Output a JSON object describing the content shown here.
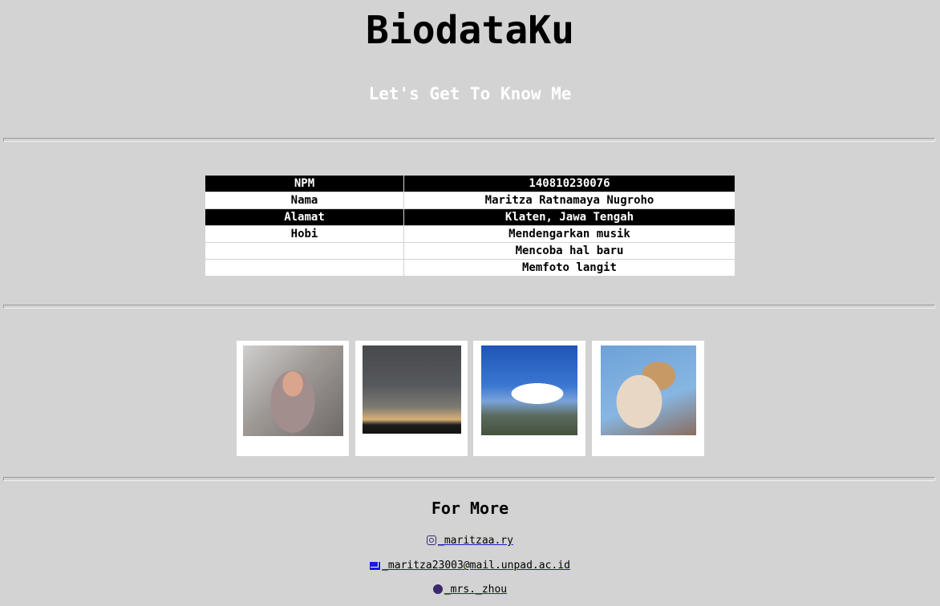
{
  "header": {
    "title": "BiodataKu",
    "subtitle": "Let's Get To Know Me"
  },
  "biodata": {
    "rows": [
      {
        "key": "NPM",
        "value": "140810230076"
      },
      {
        "key": "Nama",
        "value": "Maritza Ratnamaya Nugroho"
      },
      {
        "key": "Alamat",
        "value": "Klaten, Jawa Tengah"
      },
      {
        "key": "Hobi",
        "value": "Mendengarkan musik"
      },
      {
        "key": "",
        "value": "Mencoba hal baru"
      },
      {
        "key": "",
        "value": "Memfoto langit"
      }
    ]
  },
  "gallery": {
    "photos": [
      "selfie-photo",
      "cloudy-sky-photo",
      "blue-sky-temple-photo",
      "cat-photo"
    ]
  },
  "footer": {
    "heading": "For More",
    "instagram": "_maritzaa.ry",
    "email": "_maritza23003@mail.unpad.ac.id",
    "spotify": "_mrs._zhou",
    "icons": {
      "instagram": "instagram-icon",
      "email": "envelope-icon",
      "spotify": "spotify-icon"
    },
    "link_color": "#1a1ad6"
  },
  "colors": {
    "background": "#d3d3d3",
    "table_dark": "#000000",
    "table_light": "#ffffff"
  }
}
